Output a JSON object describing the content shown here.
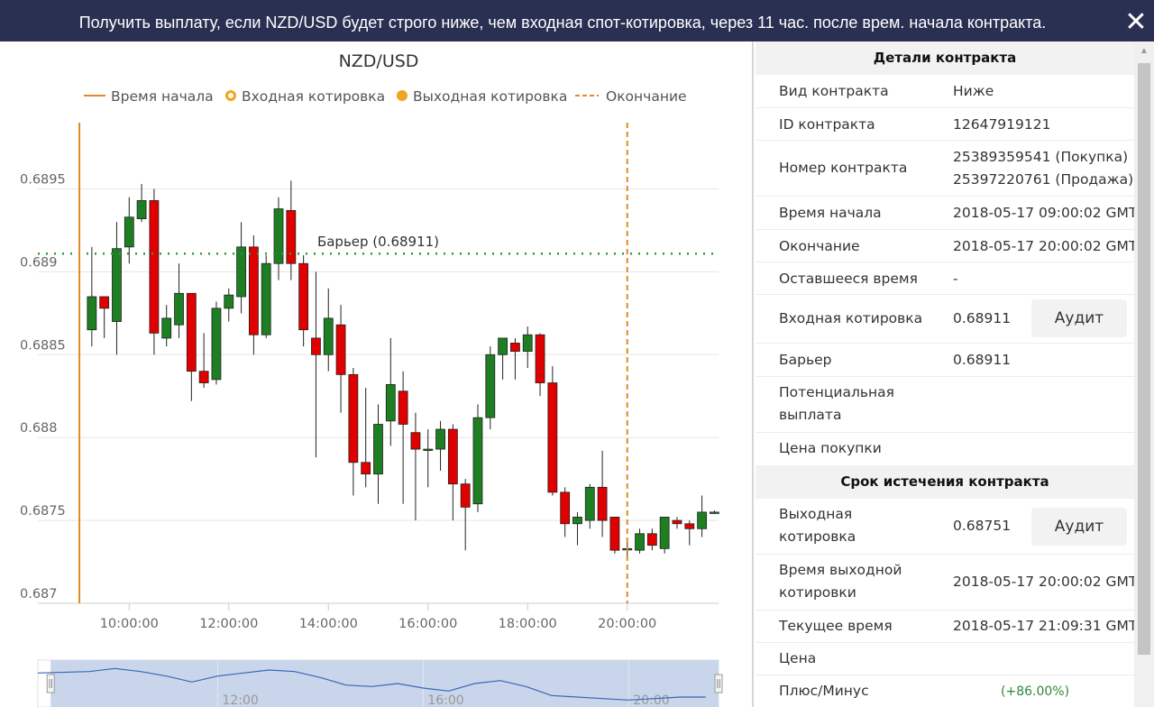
{
  "titlebar": {
    "message": "Получить выплату, если NZD/USD будет строго ниже, чем входная спот-котировка, через 11 час. после врем. начала контракта.",
    "close_label": "✕"
  },
  "chart": {
    "title": "NZD/USD",
    "legend": [
      "Время начала",
      "Входная котировка",
      "Выходная котировка",
      "Окончание"
    ],
    "barrier_label": "Барьер (0.68911)",
    "navigator_labels": [
      "12:00",
      "16:00",
      "20:00"
    ],
    "colors": {
      "up": "#1e7e22",
      "down": "#e00000",
      "accent": "#e08a2c",
      "barrier": "#2a9a3a"
    }
  },
  "chart_data": {
    "type": "candlestick",
    "title": "NZD/USD",
    "x_ticks": [
      "10:00:00",
      "12:00:00",
      "14:00:00",
      "16:00:00",
      "18:00:00",
      "20:00:00"
    ],
    "y_ticks": [
      "0.687",
      "0.6875",
      "0.688",
      "0.6885",
      "0.689",
      "0.6895"
    ],
    "ylim": [
      0.687,
      0.6899
    ],
    "candles": [
      {
        "t": "09:15",
        "o": 0.68865,
        "h": 0.68915,
        "l": 0.68855,
        "c": 0.68885
      },
      {
        "t": "09:30",
        "o": 0.68885,
        "h": 0.68885,
        "l": 0.6886,
        "c": 0.68878
      },
      {
        "t": "09:45",
        "o": 0.6887,
        "h": 0.6893,
        "l": 0.6885,
        "c": 0.68914
      },
      {
        "t": "10:00",
        "o": 0.68915,
        "h": 0.68945,
        "l": 0.68905,
        "c": 0.68933
      },
      {
        "t": "10:15",
        "o": 0.68932,
        "h": 0.68953,
        "l": 0.6893,
        "c": 0.68943
      },
      {
        "t": "10:30",
        "o": 0.68943,
        "h": 0.6895,
        "l": 0.6885,
        "c": 0.68863
      },
      {
        "t": "10:45",
        "o": 0.6886,
        "h": 0.6888,
        "l": 0.68855,
        "c": 0.68872
      },
      {
        "t": "11:00",
        "o": 0.68868,
        "h": 0.68905,
        "l": 0.6886,
        "c": 0.68887
      },
      {
        "t": "11:15",
        "o": 0.68887,
        "h": 0.68887,
        "l": 0.68822,
        "c": 0.6884
      },
      {
        "t": "11:30",
        "o": 0.6884,
        "h": 0.68863,
        "l": 0.6883,
        "c": 0.68833
      },
      {
        "t": "11:45",
        "o": 0.68835,
        "h": 0.68882,
        "l": 0.68832,
        "c": 0.68878
      },
      {
        "t": "12:00",
        "o": 0.68878,
        "h": 0.6889,
        "l": 0.6887,
        "c": 0.68886
      },
      {
        "t": "12:15",
        "o": 0.68885,
        "h": 0.6893,
        "l": 0.68875,
        "c": 0.68915
      },
      {
        "t": "12:30",
        "o": 0.68915,
        "h": 0.68922,
        "l": 0.6885,
        "c": 0.68862
      },
      {
        "t": "12:45",
        "o": 0.68862,
        "h": 0.6891,
        "l": 0.6886,
        "c": 0.68905
      },
      {
        "t": "13:00",
        "o": 0.68905,
        "h": 0.68945,
        "l": 0.68895,
        "c": 0.68938
      },
      {
        "t": "13:15",
        "o": 0.68937,
        "h": 0.68955,
        "l": 0.68895,
        "c": 0.68905
      },
      {
        "t": "13:30",
        "o": 0.68905,
        "h": 0.6891,
        "l": 0.68855,
        "c": 0.68865
      },
      {
        "t": "13:45",
        "o": 0.6886,
        "h": 0.689,
        "l": 0.68788,
        "c": 0.6885
      },
      {
        "t": "14:00",
        "o": 0.6885,
        "h": 0.6889,
        "l": 0.6884,
        "c": 0.68872
      },
      {
        "t": "14:15",
        "o": 0.68868,
        "h": 0.6888,
        "l": 0.68815,
        "c": 0.68838
      },
      {
        "t": "14:30",
        "o": 0.68838,
        "h": 0.68842,
        "l": 0.68765,
        "c": 0.68785
      },
      {
        "t": "14:45",
        "o": 0.68785,
        "h": 0.6883,
        "l": 0.6877,
        "c": 0.68778
      },
      {
        "t": "15:00",
        "o": 0.68778,
        "h": 0.6882,
        "l": 0.6876,
        "c": 0.68808
      },
      {
        "t": "15:15",
        "o": 0.6881,
        "h": 0.6886,
        "l": 0.68795,
        "c": 0.68832
      },
      {
        "t": "15:30",
        "o": 0.68828,
        "h": 0.6884,
        "l": 0.6876,
        "c": 0.68808
      },
      {
        "t": "15:45",
        "o": 0.68803,
        "h": 0.68815,
        "l": 0.6875,
        "c": 0.68793
      },
      {
        "t": "16:00",
        "o": 0.68793,
        "h": 0.68805,
        "l": 0.6877,
        "c": 0.68793
      },
      {
        "t": "16:15",
        "o": 0.68793,
        "h": 0.6881,
        "l": 0.6878,
        "c": 0.68805
      },
      {
        "t": "16:30",
        "o": 0.68805,
        "h": 0.68808,
        "l": 0.6875,
        "c": 0.68772
      },
      {
        "t": "16:45",
        "o": 0.68772,
        "h": 0.68775,
        "l": 0.68732,
        "c": 0.68758
      },
      {
        "t": "17:00",
        "o": 0.6876,
        "h": 0.6882,
        "l": 0.68755,
        "c": 0.68812
      },
      {
        "t": "17:15",
        "o": 0.68812,
        "h": 0.68855,
        "l": 0.68805,
        "c": 0.6885
      },
      {
        "t": "17:30",
        "o": 0.6885,
        "h": 0.6886,
        "l": 0.68835,
        "c": 0.6886
      },
      {
        "t": "17:45",
        "o": 0.68857,
        "h": 0.6886,
        "l": 0.68835,
        "c": 0.68852
      },
      {
        "t": "18:00",
        "o": 0.68852,
        "h": 0.68867,
        "l": 0.68842,
        "c": 0.68862
      },
      {
        "t": "18:15",
        "o": 0.68862,
        "h": 0.68863,
        "l": 0.68825,
        "c": 0.68833
      },
      {
        "t": "18:30",
        "o": 0.68833,
        "h": 0.68843,
        "l": 0.68765,
        "c": 0.68767
      },
      {
        "t": "18:45",
        "o": 0.68767,
        "h": 0.6877,
        "l": 0.6874,
        "c": 0.68748
      },
      {
        "t": "19:00",
        "o": 0.68748,
        "h": 0.68755,
        "l": 0.68735,
        "c": 0.68752
      },
      {
        "t": "19:15",
        "o": 0.6875,
        "h": 0.68772,
        "l": 0.68745,
        "c": 0.6877
      },
      {
        "t": "19:30",
        "o": 0.6877,
        "h": 0.68792,
        "l": 0.6874,
        "c": 0.6875
      },
      {
        "t": "19:45",
        "o": 0.68752,
        "h": 0.68752,
        "l": 0.6873,
        "c": 0.68732
      },
      {
        "t": "20:00",
        "o": 0.68733,
        "h": 0.68738,
        "l": 0.68728,
        "c": 0.68733
      },
      {
        "t": "20:15",
        "o": 0.68732,
        "h": 0.68745,
        "l": 0.6873,
        "c": 0.68742
      },
      {
        "t": "20:30",
        "o": 0.68742,
        "h": 0.68745,
        "l": 0.68732,
        "c": 0.68735
      },
      {
        "t": "20:45",
        "o": 0.68733,
        "h": 0.68752,
        "l": 0.6873,
        "c": 0.68752
      },
      {
        "t": "21:00",
        "o": 0.6875,
        "h": 0.68752,
        "l": 0.68745,
        "c": 0.68748
      },
      {
        "t": "21:15",
        "o": 0.68748,
        "h": 0.6875,
        "l": 0.68735,
        "c": 0.68745
      },
      {
        "t": "21:30",
        "o": 0.68745,
        "h": 0.68765,
        "l": 0.6874,
        "c": 0.68755
      },
      {
        "t": "21:45",
        "o": 0.68755,
        "h": 0.68756,
        "l": 0.68754,
        "c": 0.68755
      }
    ],
    "markers": {
      "start_time": "09:00",
      "end_time": "20:00",
      "barrier": 0.68911
    },
    "navigator": {
      "x_range": [
        "08:30",
        "21:45"
      ],
      "view_range": [
        "08:45",
        "21:45"
      ],
      "y_range": [
        0.6872,
        0.6896
      ],
      "points": [
        {
          "t": "08:30",
          "v": 0.6891
        },
        {
          "t": "09:30",
          "v": 0.6892
        },
        {
          "t": "10:00",
          "v": 0.6894
        },
        {
          "t": "10:30",
          "v": 0.6892
        },
        {
          "t": "11:00",
          "v": 0.6889
        },
        {
          "t": "11:30",
          "v": 0.6885
        },
        {
          "t": "12:00",
          "v": 0.6889
        },
        {
          "t": "12:30",
          "v": 0.6891
        },
        {
          "t": "13:00",
          "v": 0.6893
        },
        {
          "t": "13:30",
          "v": 0.6892
        },
        {
          "t": "14:00",
          "v": 0.6888
        },
        {
          "t": "14:30",
          "v": 0.6883
        },
        {
          "t": "15:00",
          "v": 0.6882
        },
        {
          "t": "15:30",
          "v": 0.6884
        },
        {
          "t": "16:00",
          "v": 0.6881
        },
        {
          "t": "16:30",
          "v": 0.6879
        },
        {
          "t": "17:00",
          "v": 0.6884
        },
        {
          "t": "17:30",
          "v": 0.6886
        },
        {
          "t": "18:00",
          "v": 0.6882
        },
        {
          "t": "18:30",
          "v": 0.6876
        },
        {
          "t": "19:00",
          "v": 0.6875
        },
        {
          "t": "19:30",
          "v": 0.6874
        },
        {
          "t": "20:00",
          "v": 0.6873
        },
        {
          "t": "20:30",
          "v": 0.6874
        },
        {
          "t": "21:00",
          "v": 0.6875
        },
        {
          "t": "21:30",
          "v": 0.6875
        }
      ]
    }
  },
  "details": {
    "header": "Детали контракта",
    "rows": [
      {
        "label": "Вид контракта",
        "value": "Ниже"
      },
      {
        "label": "ID контракта",
        "value": "12647919121"
      },
      {
        "label": "Номер контракта",
        "value": "25389359541 (Покупка)",
        "value2": "25397220761 (Продажа)"
      },
      {
        "label": "Время начала",
        "value": "2018-05-17 09:00:02 GMT"
      },
      {
        "label": "Окончание",
        "value": "2018-05-17 20:00:02 GMT"
      },
      {
        "label": "Оставшееся время",
        "value": "-"
      },
      {
        "label": "Входная котировка",
        "value": "0.68911",
        "button": "Аудит"
      },
      {
        "label": "Барьер",
        "value": "0.68911"
      },
      {
        "label": "Потенциальная",
        "label2": "выплата",
        "value": ""
      },
      {
        "label": "Цена покупки",
        "value": ""
      }
    ]
  },
  "expiry": {
    "header": "Срок истечения контракта",
    "rows": [
      {
        "label": "Выходная",
        "label2": "котировка",
        "value": "0.68751",
        "button": "Аудит"
      },
      {
        "label": "Время выходной",
        "label2": "котировки",
        "value": "2018-05-17 20:00:02 GMT"
      },
      {
        "label": "Текущее время",
        "value": "2018-05-17 21:09:31 GMT"
      },
      {
        "label": "Цена",
        "value": ""
      },
      {
        "label": "Плюс/Минус",
        "value": "(+86.00%)"
      }
    ]
  }
}
